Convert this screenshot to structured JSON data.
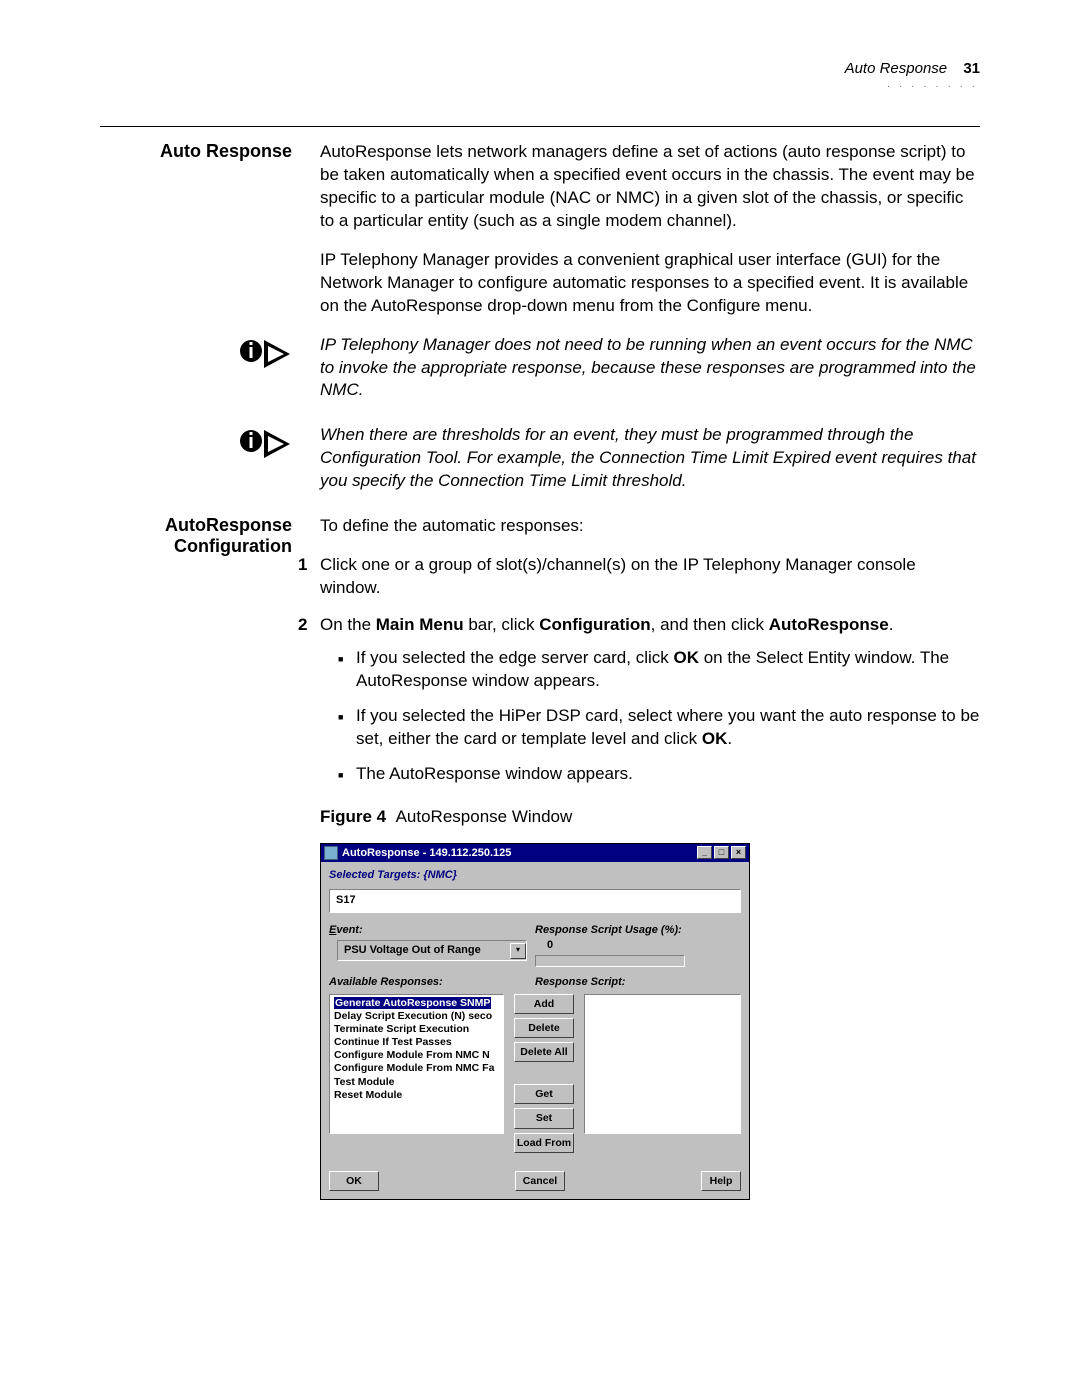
{
  "header": {
    "section": "Auto Response",
    "page": "31"
  },
  "section1": {
    "heading": "Auto Response",
    "p1": "AutoResponse lets network managers define a set of actions (auto response script) to be taken automatically when a specified event occurs in the chassis. The event may be specific to a particular module (NAC or NMC) in a given slot of the chassis, or specific to a particular entity (such as a single modem channel).",
    "p2": "IP Telephony Manager provides a convenient graphical user interface (GUI) for the Network Manager to configure automatic responses to a specified event. It is available on the AutoResponse drop-down menu from the Configure menu."
  },
  "note1": "IP Telephony Manager does not need to be running when an event occurs for the NMC to invoke the appropriate response, because these responses are programmed into the NMC.",
  "note2": "When there are thresholds for an event, they must be programmed through the Configuration Tool. For example, the Connection Time Limit Expired event requires that you specify the Connection Time Limit threshold.",
  "section2": {
    "heading1": "AutoResponse",
    "heading2": "Configuration",
    "intro": "To define the automatic responses:",
    "step1": "Click one or a group of slot(s)/channel(s) on the IP Telephony Manager console window.",
    "step2a": "On the ",
    "step2b": "Main Menu",
    "step2c": " bar, click ",
    "step2d": "Configuration",
    "step2e": ", and then click ",
    "step2f": "AutoResponse",
    "step2g": ".",
    "b1a": "If you selected the edge server card, click ",
    "b1b": "OK",
    "b1c": " on the Select Entity window. The AutoResponse window appears.",
    "b2a": "If you selected the HiPer DSP card, select where you want the auto response to be set, either the card or template level and click ",
    "b2b": "OK",
    "b2c": ".",
    "b3": "The AutoResponse window appears."
  },
  "figure": {
    "label": "Figure 4",
    "caption": "AutoResponse Window"
  },
  "window": {
    "title": "AutoResponse - 149.112.250.125",
    "selected_targets_label": "Selected Targets:  {NMC}",
    "slot": "S17",
    "event_label": "Event:",
    "event_value": "PSU Voltage Out of Range",
    "usage_label": "Response Script Usage (%):",
    "usage_value": "0",
    "avail_label": "Available Responses:",
    "rs_label": "Response Script:",
    "responses": [
      "Generate AutoResponse SNMP",
      "Delay Script Execution (N) seco",
      "Terminate Script Execution",
      "Continue If Test Passes",
      "Configure Module From NMC N",
      "Configure Module From NMC Fa",
      "Test Module",
      "Reset Module"
    ],
    "buttons": {
      "add": "Add",
      "delete": "Delete",
      "delete_all": "Delete All",
      "get": "Get",
      "set": "Set",
      "load_from": "Load From",
      "ok": "OK",
      "cancel": "Cancel",
      "help": "Help"
    }
  }
}
